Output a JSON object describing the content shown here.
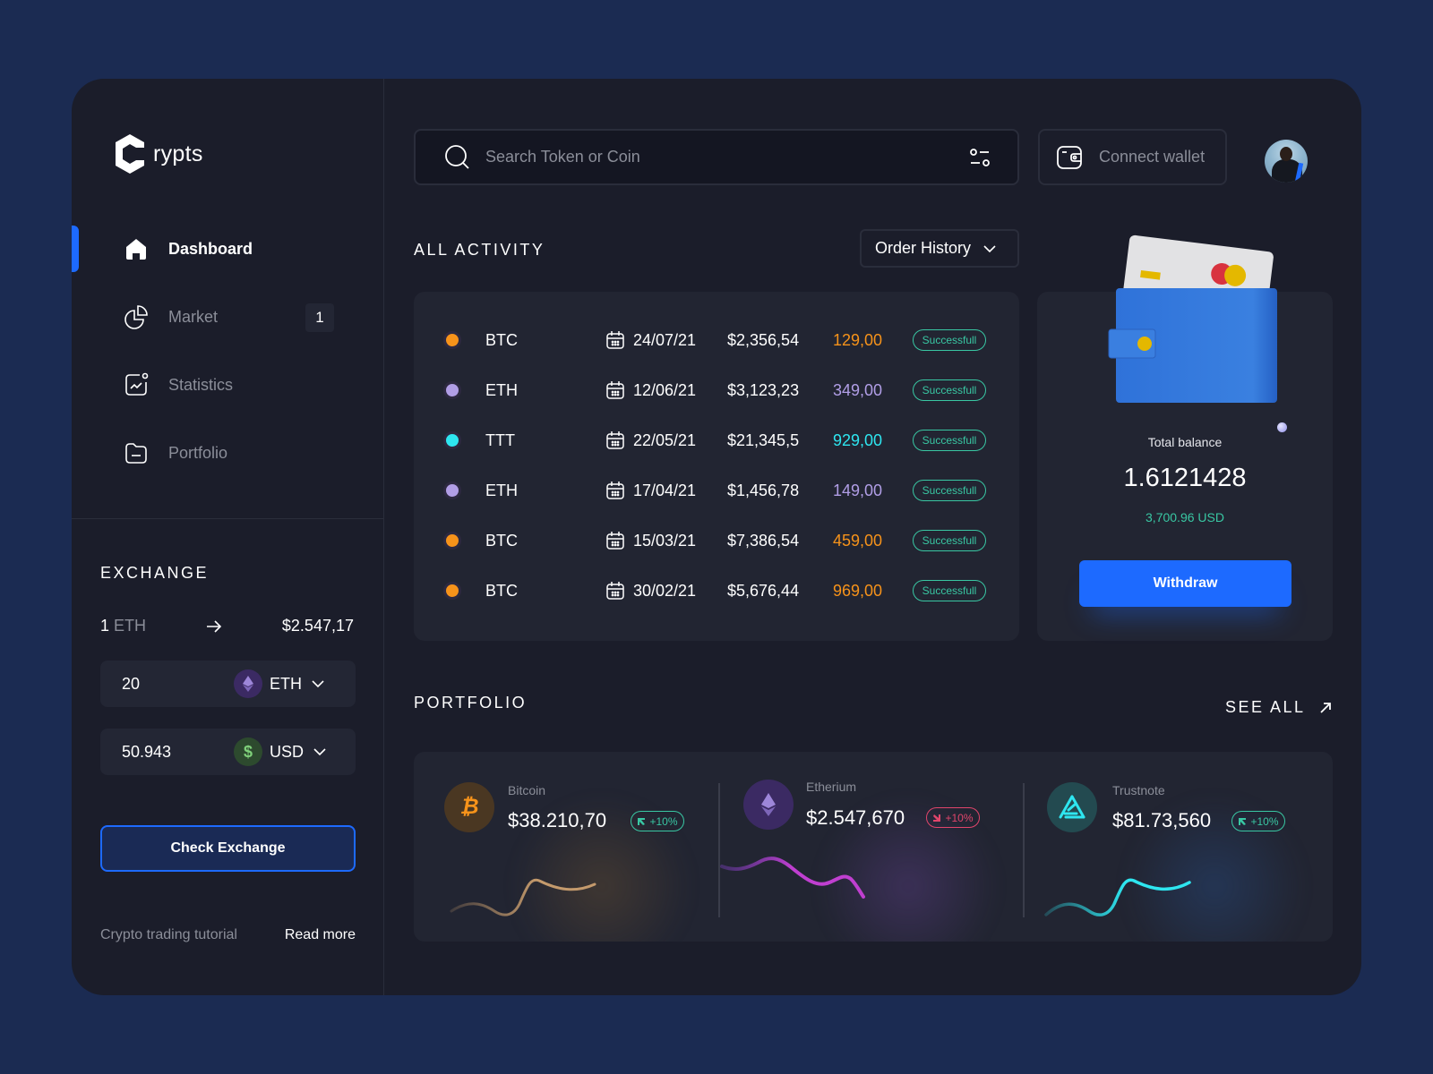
{
  "app": {
    "name": "rypts"
  },
  "sidebar": {
    "nav": [
      {
        "label": "Dashboard",
        "icon": "home-icon",
        "active": true
      },
      {
        "label": "Market",
        "icon": "pie-chart-icon",
        "badge": "1"
      },
      {
        "label": "Statistics",
        "icon": "chart-icon"
      },
      {
        "label": "Portfolio",
        "icon": "folder-icon"
      }
    ],
    "exchange": {
      "title": "EXCHANGE",
      "rate_amount": "1",
      "rate_unit": "ETH",
      "rate_value": "$2.547,17",
      "from": {
        "value": "20",
        "currency": "ETH"
      },
      "to": {
        "value": "50.943",
        "currency": "USD"
      },
      "button": "Check Exchange"
    },
    "tutorial": {
      "label": "Crypto trading tutorial",
      "link": "Read more"
    }
  },
  "header": {
    "search_placeholder": "Search Token or Coin",
    "connect_wallet": "Connect wallet"
  },
  "activity": {
    "title": "ALL ACTIVITY",
    "filter": "Order History",
    "rows": [
      {
        "symbol": "BTC",
        "date": "24/07/21",
        "price": "$2,356,54",
        "amount": "129,00",
        "status": "Successfull",
        "color": "#f7931a"
      },
      {
        "symbol": "ETH",
        "date": "12/06/21",
        "price": "$3,123,23",
        "amount": "349,00",
        "status": "Successfull",
        "color": "#b19ee6"
      },
      {
        "symbol": "TTT",
        "date": "22/05/21",
        "price": "$21,345,5",
        "amount": "929,00",
        "status": "Successfull",
        "color": "#2ee6f0"
      },
      {
        "symbol": "ETH",
        "date": "17/04/21",
        "price": "$1,456,78",
        "amount": "149,00",
        "status": "Successfull",
        "color": "#b19ee6"
      },
      {
        "symbol": "BTC",
        "date": "15/03/21",
        "price": "$7,386,54",
        "amount": "459,00",
        "status": "Successfull",
        "color": "#f7931a"
      },
      {
        "symbol": "BTC",
        "date": "30/02/21",
        "price": "$5,676,44",
        "amount": "969,00",
        "status": "Successfull",
        "color": "#f7931a"
      }
    ]
  },
  "balance": {
    "label": "Total balance",
    "value": "1.6121428",
    "usd": "3,700.96 USD",
    "button": "Withdraw"
  },
  "portfolio": {
    "title": "PORTFOLIO",
    "see_all": "SEE ALL",
    "cards": [
      {
        "name": "Bitcoin",
        "value": "$38.210,70",
        "change": "+10%",
        "trend": "up",
        "color": "#c49a6c"
      },
      {
        "name": "Etherium",
        "value": "$2.547,670",
        "change": "+10%",
        "trend": "down",
        "color": "#c03fd0"
      },
      {
        "name": "Trustnote",
        "value": "$81.73,560",
        "change": "+10%",
        "trend": "up",
        "color": "#2ee6f0"
      }
    ]
  },
  "colors": {
    "accent": "#1d6aff",
    "success": "#39c7a3",
    "danger": "#e0456b"
  }
}
